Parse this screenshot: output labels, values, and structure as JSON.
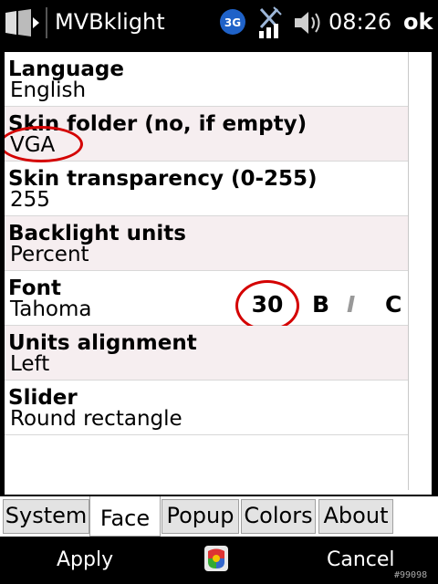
{
  "titlebar": {
    "title": "MVBklight",
    "network_badge": "3G",
    "time": "08:26",
    "ok_label": "ok"
  },
  "settings": [
    {
      "label": "Language",
      "value": "English"
    },
    {
      "label": "Skin folder (no, if empty)",
      "value": "VGA"
    },
    {
      "label": "Skin transparency (0-255)",
      "value": "255"
    },
    {
      "label": "Backlight units",
      "value": "Percent"
    },
    {
      "label": "Font",
      "value": "Tahoma"
    },
    {
      "label": "Units alignment",
      "value": "Left"
    },
    {
      "label": "Slider",
      "value": "Round rectangle"
    }
  ],
  "font_options": {
    "size": "30",
    "bold": "B",
    "italic": "I",
    "c": "C"
  },
  "tabs": [
    {
      "label": "System",
      "active": false
    },
    {
      "label": "Face",
      "active": true
    },
    {
      "label": "Popup",
      "active": false
    },
    {
      "label": "Colors",
      "active": false
    },
    {
      "label": "About",
      "active": false
    }
  ],
  "menubar": {
    "left_softkey": "Apply",
    "right_softkey": "Cancel",
    "watermark": "#99098"
  },
  "colors": {
    "highlight_circle": "#d40000",
    "shaded_row": "#f6eef0",
    "background": "#000000"
  }
}
